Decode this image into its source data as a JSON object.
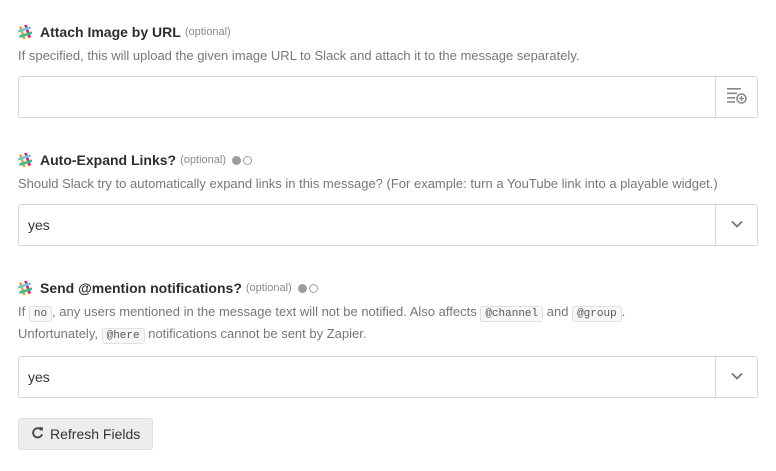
{
  "fields": [
    {
      "label": "Attach Image by URL",
      "optional": "(optional)",
      "help": "If specified, this will upload the given image URL to Slack and attach it to the message separately.",
      "input_value": "",
      "side_icon": "insert-field-icon"
    },
    {
      "label": "Auto-Expand Links?",
      "optional": "(optional)",
      "help": "Should Slack try to automatically expand links in this message? (For example: turn a YouTube link into a playable widget.)",
      "value": "yes",
      "side_icon": "chevron-down-icon"
    },
    {
      "label": "Send @mention notifications?",
      "optional": "(optional)",
      "help_parts": {
        "p1": "If ",
        "code1": "no",
        "p2": ", any users mentioned in the message text will not be notified. Also affects ",
        "code2": "@channel",
        "p3": " and ",
        "code3": "@group",
        "p4": ".",
        "line2a": "Unfortunately, ",
        "code4": "@here",
        "line2b": " notifications cannot be sent by Zapier."
      },
      "value": "yes",
      "side_icon": "chevron-down-icon"
    }
  ],
  "refresh_button": {
    "label": "Refresh Fields",
    "icon": "refresh-icon"
  },
  "colors": {
    "slack_green": "#3eb991",
    "slack_blue": "#6ecadc",
    "slack_yellow": "#e9a820",
    "slack_red": "#e01563"
  }
}
